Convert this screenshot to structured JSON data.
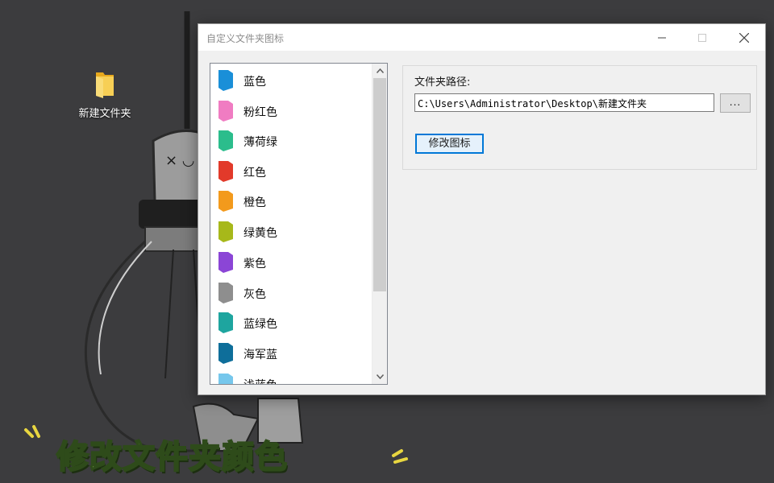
{
  "desktop": {
    "icon_label": "新建文件夹",
    "folder_color": "#f5c542"
  },
  "window": {
    "title": "自定义文件夹图标",
    "controls": {
      "minimize": "minimize-icon",
      "maximize": "maximize-icon",
      "close": "close-icon"
    }
  },
  "colors_list": {
    "items": [
      {
        "label": "蓝色",
        "color": "#1a8fd8"
      },
      {
        "label": "粉红色",
        "color": "#f07cc2"
      },
      {
        "label": "薄荷绿",
        "color": "#2bbd8c"
      },
      {
        "label": "红色",
        "color": "#e23a2a"
      },
      {
        "label": "橙色",
        "color": "#f39a1c"
      },
      {
        "label": "绿黄色",
        "color": "#a7b81a"
      },
      {
        "label": "紫色",
        "color": "#8b45d6"
      },
      {
        "label": "灰色",
        "color": "#8e8e8e"
      },
      {
        "label": "蓝绿色",
        "color": "#1ea59f"
      },
      {
        "label": "海军蓝",
        "color": "#0e6e9a"
      },
      {
        "label": "浅蓝色",
        "color": "#76c7ec"
      }
    ]
  },
  "folder_path": {
    "label": "文件夹路径:",
    "value": "C:\\Users\\Administrator\\Desktop\\新建文件夹",
    "browse_label": "..."
  },
  "modify_button": {
    "label": "修改图标"
  },
  "overlay_caption": "修改文件夹颜色",
  "accent_color": "#0078d7"
}
